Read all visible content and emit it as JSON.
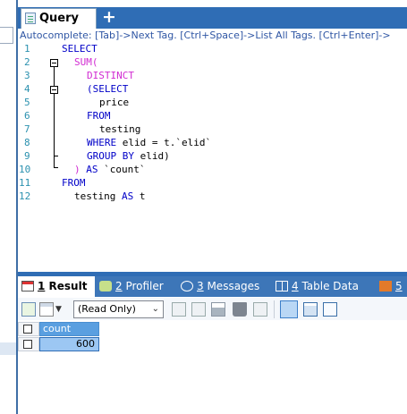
{
  "tabs": {
    "query_label": "Query",
    "add_label": "+"
  },
  "autocomplete_hint": "Autocomplete: [Tab]->Next Tag. [Ctrl+Space]->List All Tags. [Ctrl+Enter]->",
  "editor": {
    "line_numbers": [
      "1",
      "2",
      "3",
      "4",
      "5",
      "6",
      "7",
      "8",
      "9",
      "10",
      "11",
      "12"
    ],
    "lines": [
      "SELECT",
      "SUM(",
      "DISTINCT",
      "(SELECT",
      "price",
      "FROM",
      "testing",
      "WHERE elid = t.`elid`",
      "GROUP BY elid)",
      ") AS `count`",
      "FROM",
      "testing AS t"
    ],
    "tokens": {
      "l1": "SELECT",
      "l2": "SUM(",
      "l3": "DISTINCT",
      "l4": "(SELECT",
      "l5": "price",
      "l6": "FROM",
      "l7": "testing",
      "l8a": "WHERE",
      "l8b": " elid = t.`elid`",
      "l9a": "GROUP BY",
      "l9b": " elid)",
      "l10a": ") ",
      "l10b": "AS",
      "l10c": " `count`",
      "l11": "FROM",
      "l12a": "testing ",
      "l12b": "AS",
      "l12c": " t"
    }
  },
  "result_tabs": {
    "result": {
      "num": "1",
      "label": " Result"
    },
    "profiler": {
      "num": "2",
      "label": " Profiler"
    },
    "messages": {
      "num": "3",
      "label": " Messages"
    },
    "table_data": {
      "num": "4",
      "label": " Table Data"
    },
    "more": {
      "num": "5",
      "label": ""
    }
  },
  "toolbar": {
    "mode_select_value": "(Read Only)",
    "icons": [
      "add-row-icon",
      "grid-menu-icon",
      "save-icon",
      "delete-icon",
      "cancel-icon",
      "grid-view-icon",
      "form-view-icon",
      "text-view-icon"
    ]
  },
  "grid": {
    "columns": [
      "count"
    ],
    "rows": [
      [
        "600"
      ]
    ]
  },
  "colors": {
    "accent": "#2f6db5",
    "keyword": "#0000c8",
    "function": "#d12bd2",
    "line_number": "#2b91af",
    "hint": "#2f56a4",
    "selected_cell": "#9cc7f3"
  }
}
